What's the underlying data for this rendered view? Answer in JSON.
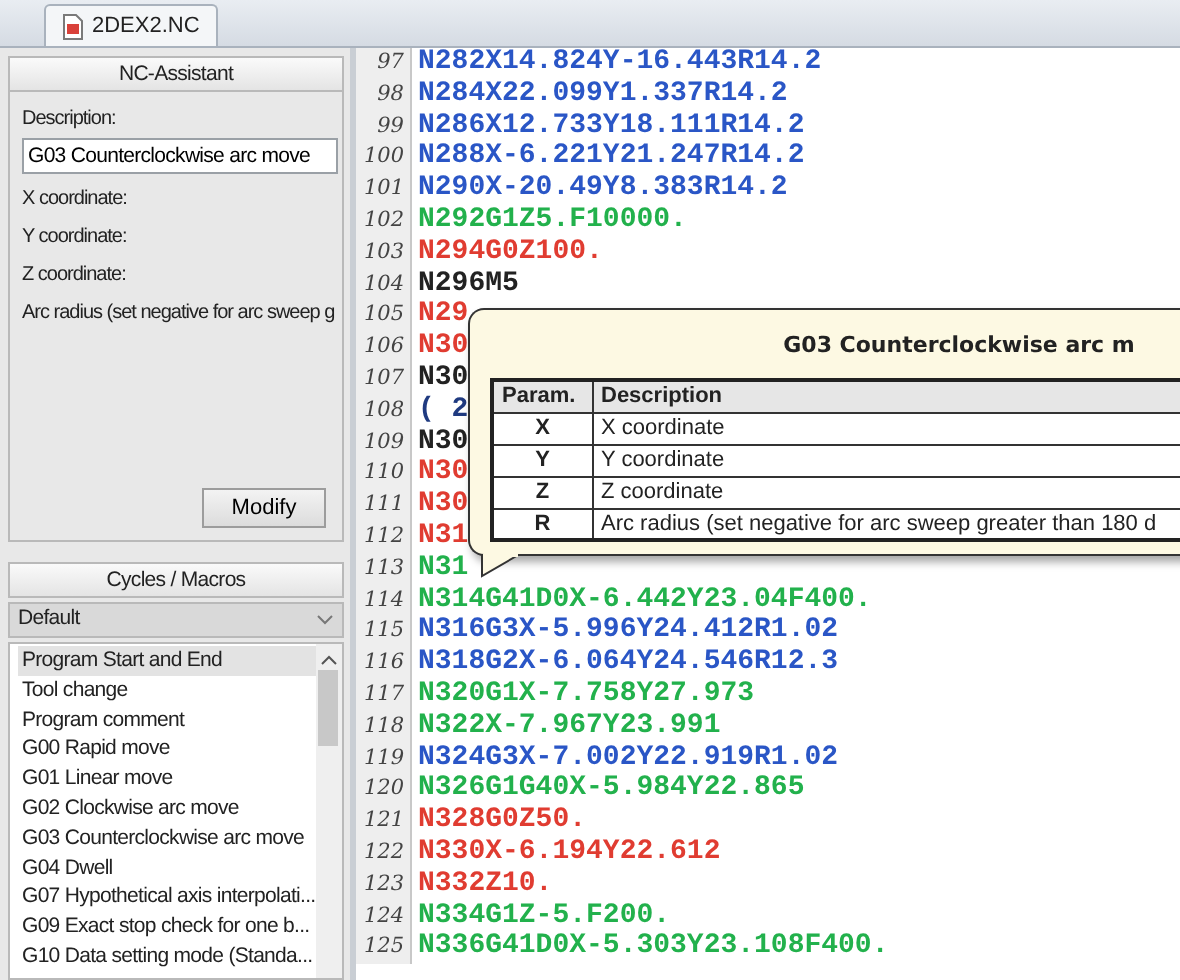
{
  "tabs": [
    {
      "label": "2DEX2.NC",
      "selected": true
    }
  ],
  "nc_assistant": {
    "title": "NC-Assistant",
    "description_label": "Description:",
    "description_value": "G03 Counterclockwise arc move",
    "fields": [
      "X coordinate:",
      "Y coordinate:",
      "Z coordinate:",
      "Arc radius (set negative for arc sweep g"
    ],
    "button": "Modify"
  },
  "cycles_macros": {
    "title": "Cycles / Macros",
    "dropdown": "Default",
    "items": [
      {
        "label": "Program Start and End",
        "selected": true
      },
      {
        "label": "Tool change",
        "selected": false
      },
      {
        "label": "Program comment",
        "selected": false
      },
      {
        "label": "G00 Rapid move",
        "selected": false
      },
      {
        "label": "G01 Linear move",
        "selected": false
      },
      {
        "label": "G02 Clockwise arc move",
        "selected": false
      },
      {
        "label": "G03 Counterclockwise arc move",
        "selected": false
      },
      {
        "label": "G04 Dwell",
        "selected": false
      },
      {
        "label": "G07 Hypothetical axis interpolati...",
        "selected": false
      },
      {
        "label": "G09 Exact stop check for one b...",
        "selected": false
      },
      {
        "label": "G10 Data setting mode (Standa...",
        "selected": false
      }
    ]
  },
  "editor": {
    "lines": [
      {
        "number": "97",
        "code": "N282X14.824Y-16.443R14.2",
        "color": "#2a56c6"
      },
      {
        "number": "98",
        "code": "N284X22.099Y1.337R14.2",
        "color": "#2a56c6"
      },
      {
        "number": "99",
        "code": "N286X12.733Y18.111R14.2",
        "color": "#2a56c6"
      },
      {
        "number": "100",
        "code": "N288X-6.221Y21.247R14.2",
        "color": "#2a56c6"
      },
      {
        "number": "101",
        "code": "N290X-20.49Y8.383R14.2",
        "color": "#2a56c6"
      },
      {
        "number": "102",
        "code": "N292G1Z5.F10000.",
        "color": "#22b14c"
      },
      {
        "number": "103",
        "code": "N294G0Z100.",
        "color": "#e03c31"
      },
      {
        "number": "104",
        "code": "N296M5",
        "color": "#222222"
      },
      {
        "number": "105",
        "code": "N29",
        "color": "#e03c31"
      },
      {
        "number": "106",
        "code": "N30",
        "color": "#e03c31"
      },
      {
        "number": "107",
        "code": "N30",
        "color": "#222222"
      },
      {
        "number": "108",
        "code": "( 2",
        "color": "#1f3a80"
      },
      {
        "number": "109",
        "code": "N30",
        "color": "#222222"
      },
      {
        "number": "110",
        "code": "N30",
        "color": "#e03c31"
      },
      {
        "number": "111",
        "code": "N30",
        "color": "#e03c31"
      },
      {
        "number": "112",
        "code": "N31",
        "color": "#e03c31"
      },
      {
        "number": "113",
        "code": "N31",
        "color": "#22b14c"
      },
      {
        "number": "114",
        "code": "N314G41D0X-6.442Y23.04F400.",
        "color": "#22b14c"
      },
      {
        "number": "115",
        "code": "N316G3X-5.996Y24.412R1.02",
        "color": "#2a56c6"
      },
      {
        "number": "116",
        "code": "N318G2X-6.064Y24.546R12.3",
        "color": "#2a56c6"
      },
      {
        "number": "117",
        "code": "N320G1X-7.758Y27.973",
        "color": "#22b14c"
      },
      {
        "number": "118",
        "code": "N322X-7.967Y23.991",
        "color": "#22b14c"
      },
      {
        "number": "119",
        "code": "N324G3X-7.002Y22.919R1.02",
        "color": "#2a56c6"
      },
      {
        "number": "120",
        "code": "N326G1G40X-5.984Y22.865",
        "color": "#22b14c"
      },
      {
        "number": "121",
        "code": "N328G0Z50.",
        "color": "#e03c31"
      },
      {
        "number": "122",
        "code": "N330X-6.194Y22.612",
        "color": "#e03c31"
      },
      {
        "number": "123",
        "code": "N332Z10.",
        "color": "#e03c31"
      },
      {
        "number": "124",
        "code": "N334G1Z-5.F200.",
        "color": "#22b14c"
      },
      {
        "number": "125",
        "code": "N336G41D0X-5.303Y23.108F400.",
        "color": "#22b14c"
      }
    ]
  },
  "tooltip": {
    "title": "G03 Counterclockwise arc m",
    "columns": [
      "Param.",
      "Description"
    ],
    "rows": [
      {
        "param": "X",
        "description": "X coordinate"
      },
      {
        "param": "Y",
        "description": "Y coordinate"
      },
      {
        "param": "Z",
        "description": "Z coordinate"
      },
      {
        "param": "R",
        "description": "Arc radius (set negative for arc sweep greater than 180 d"
      }
    ]
  }
}
